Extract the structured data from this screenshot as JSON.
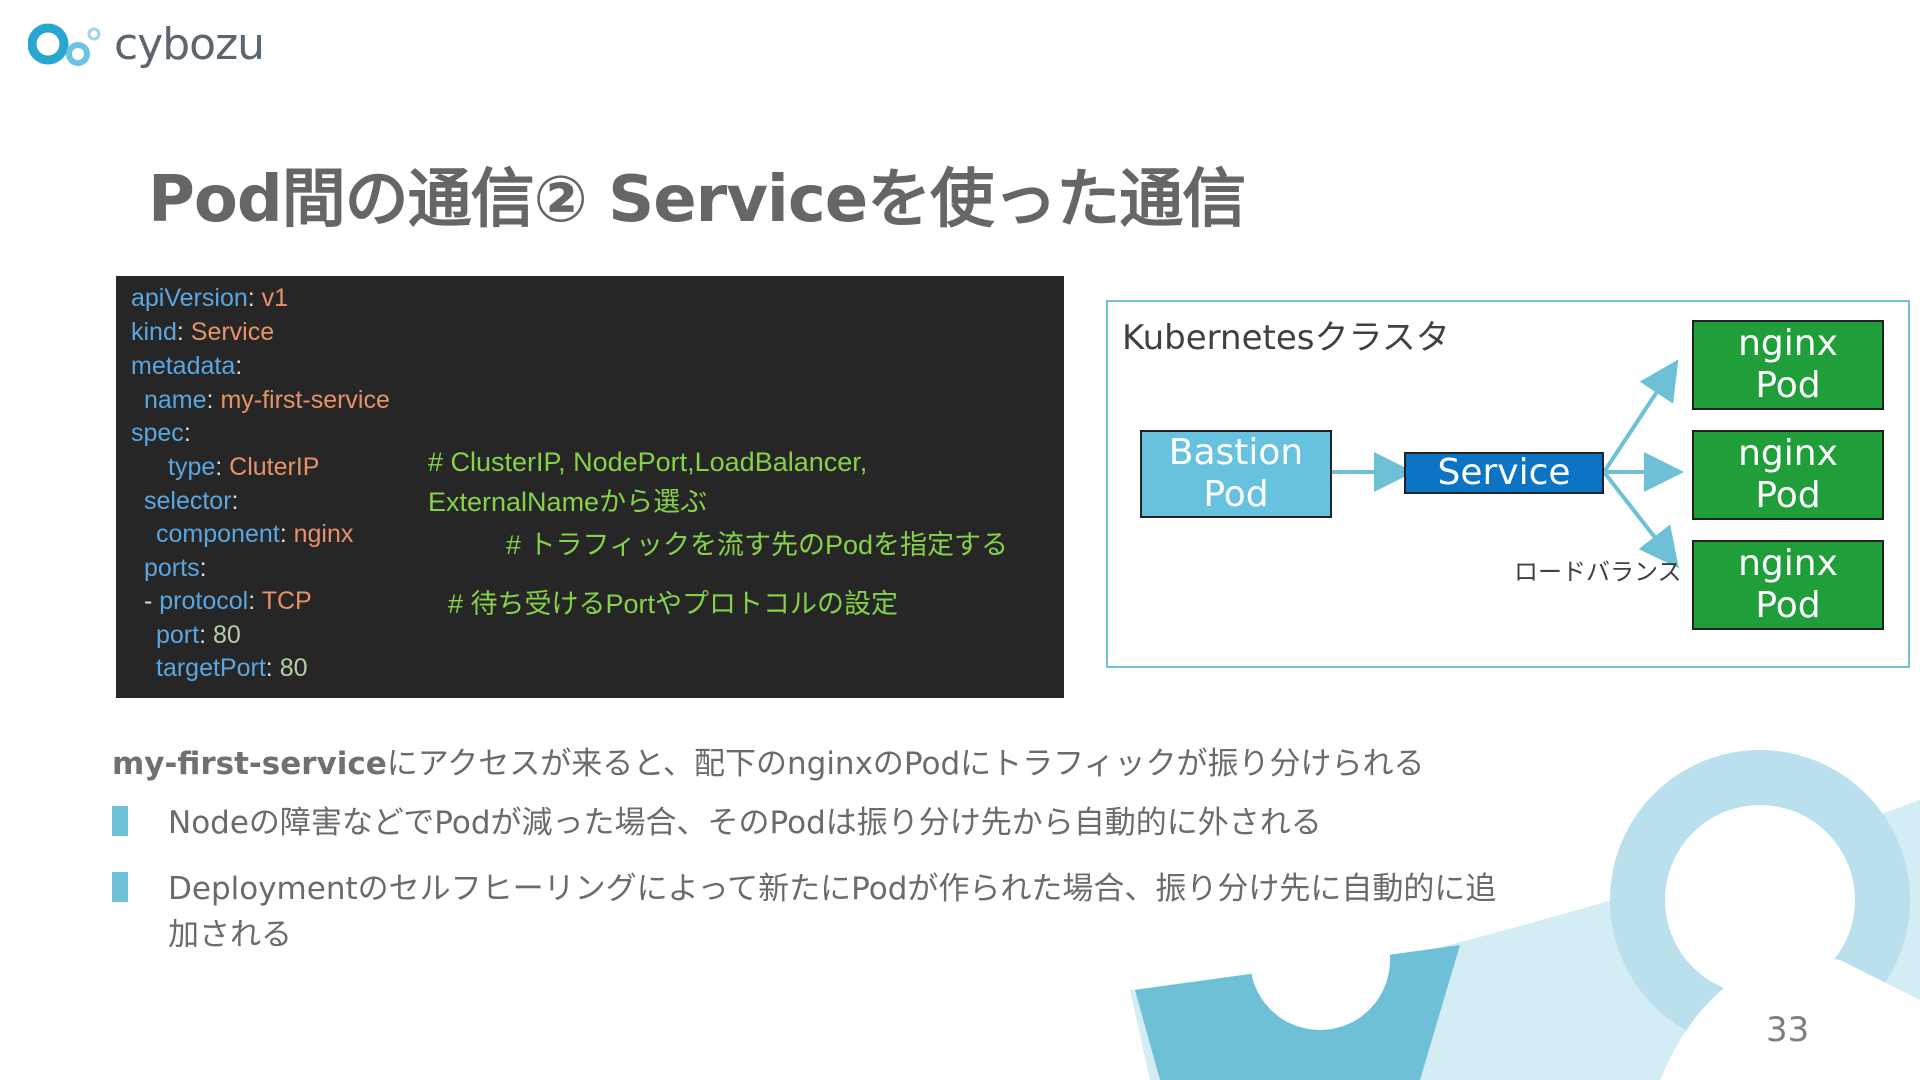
{
  "logo": {
    "text": "cybozu"
  },
  "title": "Pod間の通信② Serviceを使った通信",
  "code": {
    "lines": [
      {
        "key": "apiVersion",
        "sep": ": ",
        "val": "v1"
      },
      {
        "key": "kind",
        "sep": ": ",
        "val": "Service"
      },
      {
        "key": "metadata",
        "sep": ":",
        "val": ""
      },
      {
        "key": "name",
        "sep": ": ",
        "val": "my-first-service"
      },
      {
        "key": "spec",
        "sep": ":",
        "val": ""
      },
      {
        "key": "type",
        "sep": ": ",
        "val": "CluterIP"
      },
      {
        "key": "selector",
        "sep": ":",
        "val": ""
      },
      {
        "key": "component",
        "sep": ": ",
        "val": "nginx"
      },
      {
        "key": "ports",
        "sep": ":",
        "val": ""
      },
      {
        "prefix": "- ",
        "key": "protocol",
        "sep": ": ",
        "val": "TCP"
      },
      {
        "key": "port",
        "sep": ": ",
        "val": "80"
      },
      {
        "key": "targetPort",
        "sep": ": ",
        "val": "80"
      }
    ],
    "comments": {
      "type_line1": "# ClusterIP, NodePort,LoadBalancer,",
      "type_line2": "ExternalNameから選ぶ",
      "selector": "# トラフィックを流す先のPodを指定する",
      "ports": "# 待ち受けるPortやプロトコルの設定"
    }
  },
  "diagram": {
    "cluster_label": "Kubernetesクラスタ",
    "bastion": [
      "Bastion",
      "Pod"
    ],
    "service": "Service",
    "nginx_pods": [
      [
        "nginx",
        "Pod"
      ],
      [
        "nginx",
        "Pod"
      ],
      [
        "nginx",
        "Pod"
      ]
    ],
    "load_balance_label": "ロードバランス"
  },
  "description": {
    "bold": "my-first-service",
    "rest": "にアクセスが来ると、配下のnginxのPodにトラフィックが振り分けられる"
  },
  "bullets": [
    {
      "line1": "Nodeの障害などでPodが減った場合、そのPodは振り分け先から自動的に外される",
      "line2": ""
    },
    {
      "line1": "Deploymentのセルフヒーリングによって新たにPodが作られた場合、振り分け先に自動的に追",
      "line2": "加される"
    }
  ],
  "page_number": "33",
  "colors": {
    "accent": "#6ec0d6",
    "code_bg": "#262626",
    "service": "#0b74c4",
    "nginx": "#1f9e3a",
    "bastion": "#66c2de",
    "comment": "#86d14a"
  }
}
